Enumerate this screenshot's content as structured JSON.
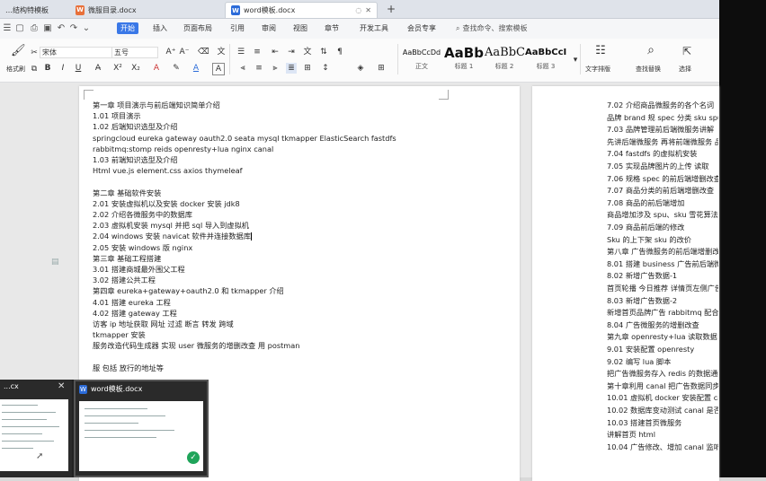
{
  "tabs": [
    {
      "label": "…结构特模板",
      "icon": "doc-icon"
    },
    {
      "label": "微服目录.docx",
      "icon": "doc-icon"
    },
    {
      "label": "word模板.docx",
      "icon": "word-icon",
      "active": true
    }
  ],
  "new_tab_label": "+",
  "menu": {
    "items": [
      "开始",
      "插入",
      "页面布局",
      "引用",
      "审阅",
      "视图",
      "章节",
      "开发工具",
      "会员专享"
    ],
    "active_index": 0,
    "search_placeholder": "查找命令、搜索模板"
  },
  "ribbon": {
    "paste_label": "格式刷",
    "font_name": "宋体",
    "font_size": "五号",
    "styles": [
      {
        "preview": "AaBbCcDd",
        "label": "正文"
      },
      {
        "preview": "AaBb",
        "label": "标题 1"
      },
      {
        "preview": "AaBbC",
        "label": "标题 2"
      },
      {
        "preview": "AaBbCcI",
        "label": "标题 3"
      }
    ],
    "text_layout_label": "文字排版",
    "find_replace_label": "查找替换",
    "select_label": "选择"
  },
  "left_page_lines": [
    "第一章  项目演示与前后端知识简单介绍",
    "1.01 项目演示",
    "1.02 后端知识选型及介绍",
    "springcloud   eureka   gateway   oauth2.0   seata   mysql   tkmapper         ElasticSearch   fastdfs",
    "rabbitmq:stomp reids openresty+lua nginx canal",
    "1.03 前端知识选型及介绍",
    "Html   vue.js   element.css   axios   thymeleaf",
    "",
    "第二章  基础软件安装",
    "2.01 安装虚拟机以及安装 docker 安装 jdk8",
    "2.02 介绍各微服务中的数据库",
    "2.03 虚拟机安装 mysql 并把 sql 导入到虚拟机",
    "2.04 windows 安装 navicat 软件并连接数据库",
    "2.05 安装 windows 版  nginx",
    "第三章  基础工程搭建",
    "3.01  搭建商城最外围父工程",
    "3.02  搭建公共工程",
    "第四章  eureka+gateway+oauth2.0 和 tkmapper 介绍",
    "4.01  搭建 eureka 工程",
    "4.02  搭建 gateway 工程",
    "访客 ip 地址获取  网址  过滤  断言  转发  跨域",
    "              tkmapper 安装",
    "              服务改造代码生成器  实现 user 微服务的增删改查  用 postman",
    "",
    "              服  包括  放行的地址等",
    "",
    "              jwt 令牌"
  ],
  "right_page_lines": [
    "7.02 介绍商品微服务的各个名词",
    "品牌 brand  规 spec  分类  sku   spu",
    "7.03 品牌管理前后端微服务讲解",
    "先讲后端微服务  再将前端微服务  品",
    "7.04 fastdfs 的虚拟机安装",
    "7.05 实现品牌图片的上传  读取",
    "7.06 规格  spec  的前后端增删改查",
    "7.07 商品分类的前后端增删改查",
    "7.08 商品的前后端增加",
    "商品增加涉及  spu、sku  雪花算法 id",
    "7.09 商品前后端的修改",
    "Sku 的上下架  sku 的改价",
    "第八章 广告微服务的前后端增删改查",
    "8.01 搭建  business 广告前后端微服务",
    "8.02 新增广告数据-1",
    "首页轮播  今日推荐  详情页左侧广告",
    "8.03 新增广告数据-2",
    "新增首页品牌广告  rabbitmq  配合商",
    "8.04 广告微服务的增删改查",
    "第九章 openresty+lua 读取数据",
    "9.01 安装配置  openresty",
    "9.02 编写  lua 脚本",
    "把广告微服务存入  redis  的数据通过",
    "第十章利用 canal 把广告数据同步到",
    "10.01 虚拟机 docker 安装配置 canal",
    "10.02 数据库变动测试  canal 是否生效",
    "10.03 搭建首页微服务",
    "讲解首页 html",
    "10.04 广告修改、增加 canal 监听测试"
  ],
  "switcher": {
    "thumbs": [
      {
        "title": "...cx"
      },
      {
        "title": "word模板.docx"
      }
    ]
  }
}
